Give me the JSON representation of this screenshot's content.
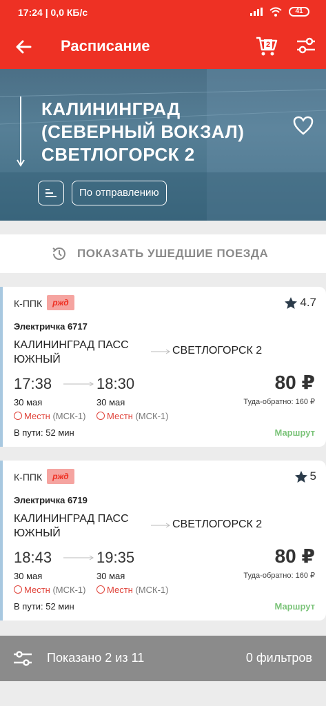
{
  "status": {
    "time": "17:24",
    "speed": "0,0 КБ/с",
    "battery": "41"
  },
  "appbar": {
    "title": "Расписание",
    "cart_count": "2"
  },
  "header": {
    "line1": "КАЛИНИНГРАД",
    "line2": "(СЕВЕРНЫЙ ВОКЗАЛ)",
    "line3": "СВЕТЛОГОРСК 2",
    "sort_label": "По отправлению"
  },
  "show_departed_label": "ПОКАЗАТЬ УШЕДШИЕ ПОЕЗДА",
  "trains": [
    {
      "carrier": "К-ППК",
      "logo": "ржд",
      "rating": "4.7",
      "name": "Электричка 6717",
      "from": "КАЛИНИНГРАД ПАСС ЮЖНЫЙ",
      "to": "СВЕТЛОГОРСК 2",
      "dep_time": "17:38",
      "arr_time": "18:30",
      "dep_date": "30 мая",
      "arr_date": "30 мая",
      "dep_zone": "Местн",
      "dep_zone_msk": "(МСК-1)",
      "arr_zone": "Местн",
      "arr_zone_msk": "(МСК-1)",
      "price": "80 ₽",
      "roundtrip": "Туда-обратно: 160 ₽",
      "travel": "В пути: 52 мин",
      "route_label": "Маршрут"
    },
    {
      "carrier": "К-ППК",
      "logo": "ржд",
      "rating": "5",
      "name": "Электричка 6719",
      "from": "КАЛИНИНГРАД ПАСС ЮЖНЫЙ",
      "to": "СВЕТЛОГОРСК 2",
      "dep_time": "18:43",
      "arr_time": "19:35",
      "dep_date": "30 мая",
      "arr_date": "30 мая",
      "dep_zone": "Местн",
      "dep_zone_msk": "(МСК-1)",
      "arr_zone": "Местн",
      "arr_zone_msk": "(МСК-1)",
      "price": "80 ₽",
      "roundtrip": "Туда-обратно: 160 ₽",
      "travel": "В пути: 52 мин",
      "route_label": "Маршрут"
    }
  ],
  "footer": {
    "shown": "Показано 2 из 11",
    "filters": "0 фильтров"
  },
  "colors": {
    "brand_red": "#ee3124",
    "route_green": "#7cc47a",
    "footer_gray": "#8b8b8b"
  }
}
